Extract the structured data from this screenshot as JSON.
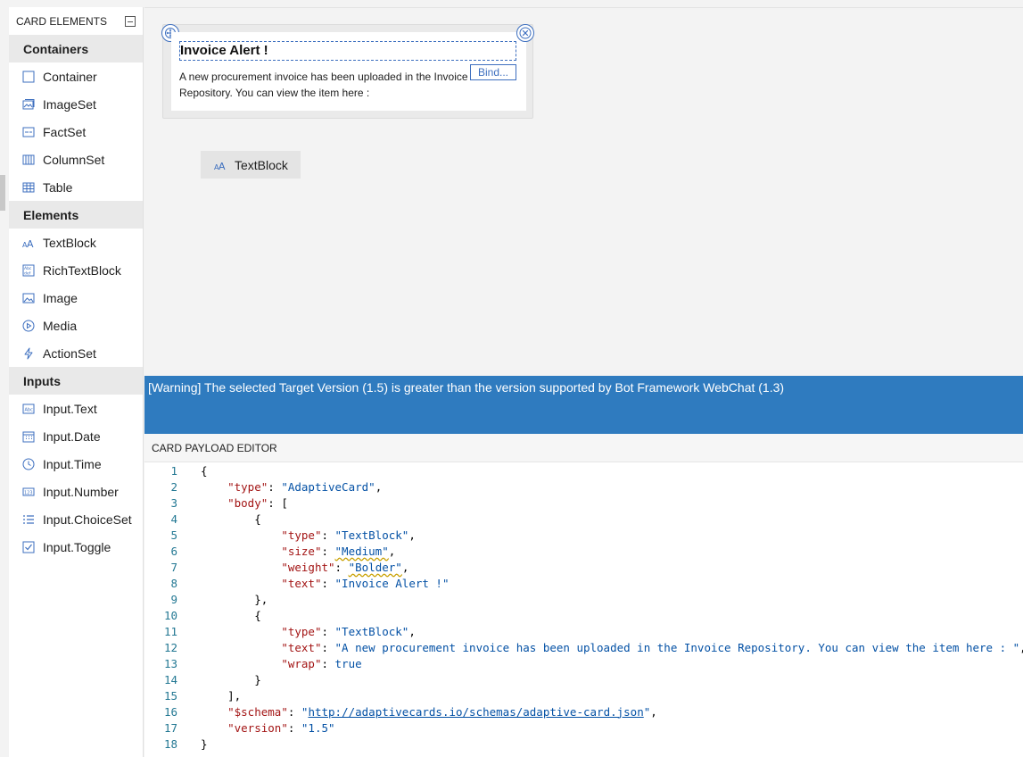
{
  "sidebar": {
    "header": "CARD ELEMENTS",
    "categories": [
      {
        "label": "Containers",
        "items": [
          {
            "label": "Container",
            "icon": "container-icon"
          },
          {
            "label": "ImageSet",
            "icon": "imageset-icon"
          },
          {
            "label": "FactSet",
            "icon": "factset-icon"
          },
          {
            "label": "ColumnSet",
            "icon": "columnset-icon"
          },
          {
            "label": "Table",
            "icon": "table-icon"
          }
        ]
      },
      {
        "label": "Elements",
        "items": [
          {
            "label": "TextBlock",
            "icon": "textblock-icon"
          },
          {
            "label": "RichTextBlock",
            "icon": "richtextblock-icon"
          },
          {
            "label": "Image",
            "icon": "image-icon"
          },
          {
            "label": "Media",
            "icon": "media-icon"
          },
          {
            "label": "ActionSet",
            "icon": "actionset-icon"
          }
        ]
      },
      {
        "label": "Inputs",
        "items": [
          {
            "label": "Input.Text",
            "icon": "input-text-icon"
          },
          {
            "label": "Input.Date",
            "icon": "input-date-icon"
          },
          {
            "label": "Input.Time",
            "icon": "input-time-icon"
          },
          {
            "label": "Input.Number",
            "icon": "input-number-icon"
          },
          {
            "label": "Input.ChoiceSet",
            "icon": "input-choiceset-icon"
          },
          {
            "label": "Input.Toggle",
            "icon": "input-toggle-icon"
          }
        ]
      }
    ]
  },
  "card": {
    "title": "Invoice Alert !",
    "body": "A new procurement invoice has been uploaded in the Invoice Repository. You can view the item here :",
    "bind_label": "Bind..."
  },
  "drag_chip": {
    "label": "TextBlock"
  },
  "warning": "[Warning] The selected Target Version (1.5) is greater than the version supported by Bot Framework WebChat (1.3)",
  "editor": {
    "title": "CARD PAYLOAD EDITOR",
    "lines": [
      "{",
      "    \"type\": \"AdaptiveCard\",",
      "    \"body\": [",
      "        {",
      "            \"type\": \"TextBlock\",",
      "            \"size\": \"Medium\",",
      "            \"weight\": \"Bolder\",",
      "            \"text\": \"Invoice Alert !\"",
      "        },",
      "        {",
      "            \"type\": \"TextBlock\",",
      "            \"text\": \"A new procurement invoice has been uploaded in the Invoice Repository. You can view the item here : \",",
      "            \"wrap\": true",
      "        }",
      "    ],",
      "    \"$schema\": \"http://adaptivecards.io/schemas/adaptive-card.json\",",
      "    \"version\": \"1.5\"",
      "}"
    ]
  }
}
